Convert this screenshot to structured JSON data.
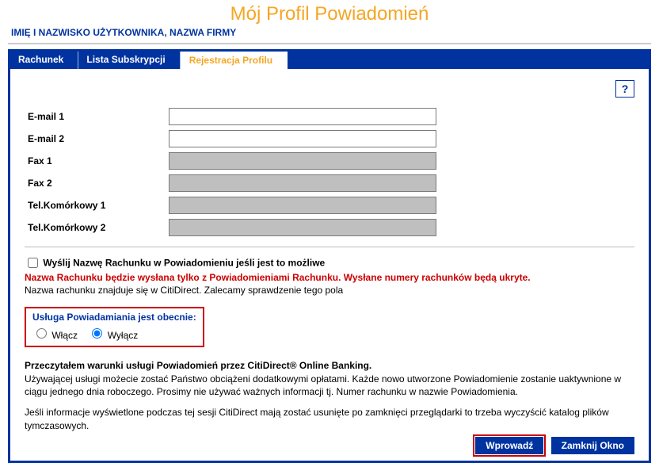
{
  "header": {
    "title": "Mój Profil Powiadomień",
    "user_info": "IMIĘ I NAZWISKO UŻYTKOWNIKA, NAZWA FIRMY"
  },
  "tabs": {
    "items": [
      {
        "label": "Rachunek"
      },
      {
        "label": "Lista Subskrypcji"
      },
      {
        "label": "Rejestracja Profilu"
      }
    ]
  },
  "help": {
    "label": "?"
  },
  "form": {
    "email1": {
      "label": "E-mail 1",
      "value": ""
    },
    "email2": {
      "label": "E-mail 2",
      "value": ""
    },
    "fax1": {
      "label": "Fax 1",
      "value": ""
    },
    "fax2": {
      "label": "Fax 2",
      "value": ""
    },
    "cell1": {
      "label": "Tel.Komórkowy 1",
      "value": ""
    },
    "cell2": {
      "label": "Tel.Komórkowy 2",
      "value": ""
    }
  },
  "send_name": {
    "checkbox_label": "Wyślij Nazwę Rachunku w Powiadomieniu jeśli jest to możliwe",
    "warning": "Nazwa Rachunku będzie wysłana tylko z Powiadomieniami Rachunku. Wysłane numery rachunków będą ukryte.",
    "note": "Nazwa rachunku znajduje się w CitiDirect. Zalecamy sprawdzenie tego pola"
  },
  "service": {
    "title": "Usługa Powiadamiania jest obecnie:",
    "on_label": "Włącz",
    "off_label": "Wyłącz"
  },
  "terms": {
    "title": "Przeczytałem warunki usługi Powiadomień przez CitiDirect® Online Banking.",
    "text": "Używającej usługi możecie zostać Państwo obciążeni dodatkowymi opłatami. Każde nowo utworzone Powiadomienie zostanie uaktywnione w ciągu jednego dnia roboczego. Prosimy nie używać ważnych informacji tj. Numer rachunku w nazwie Powiadomienia."
  },
  "session_note": "Jeśli informacje wyświetlone podczas tej sesji CitiDirect mają zostać usunięte po zamknięci przeglądarki to trzeba wyczyścić katalog plików tymczasowych.",
  "buttons": {
    "submit": "Wprowadź",
    "close": "Zamknij Okno"
  }
}
